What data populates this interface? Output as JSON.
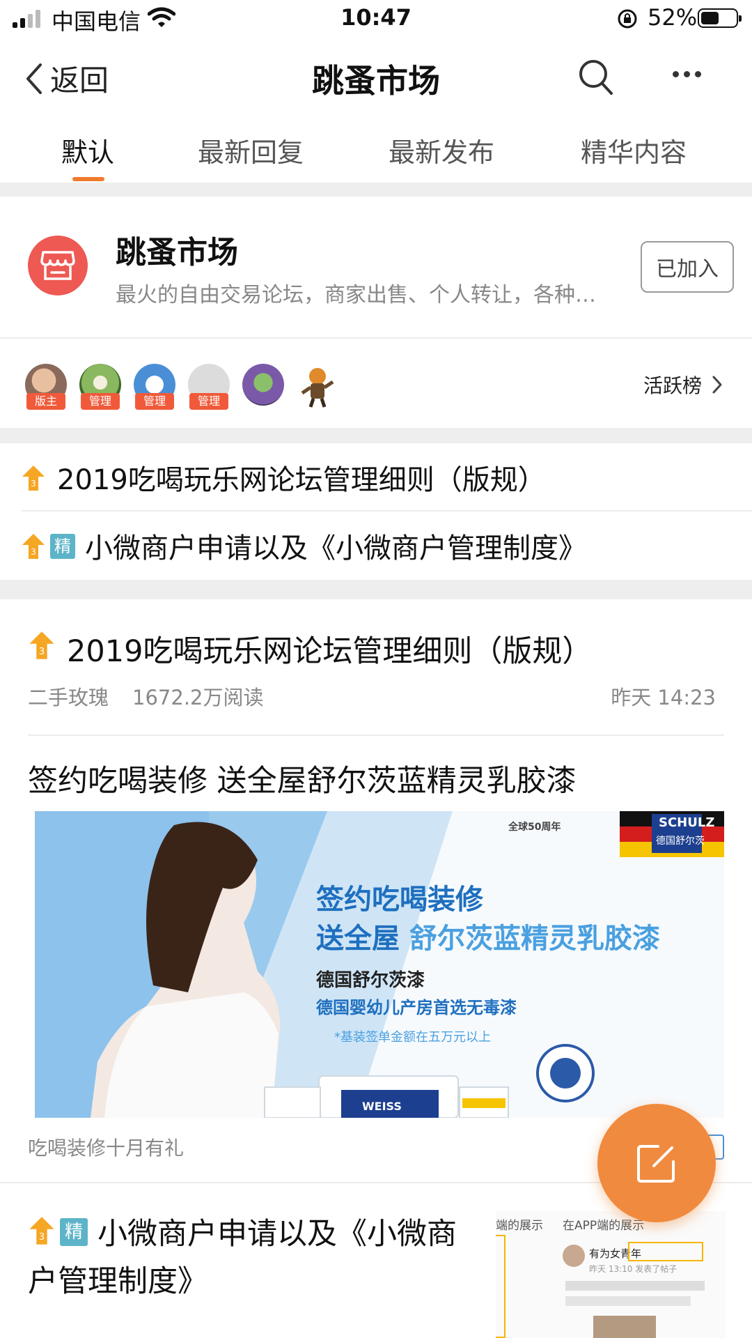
{
  "status_bar": {
    "carrier": "中国电信",
    "time": "10:47",
    "battery": "52%",
    "battery_level": 0.52
  },
  "nav": {
    "back_label": "返回",
    "title": "跳蚤市场"
  },
  "tabs": [
    {
      "label": "默认",
      "active": true
    },
    {
      "label": "最新回复",
      "active": false
    },
    {
      "label": "最新发布",
      "active": false
    },
    {
      "label": "精华内容",
      "active": false
    }
  ],
  "forum": {
    "name": "跳蚤市场",
    "description": "最火的自由交易论坛，商家出售、个人转让，各种…",
    "join_label": "已加入"
  },
  "moderators": [
    {
      "tag": "版主",
      "color": "#b08a70"
    },
    {
      "tag": "管理",
      "color": "#7aa65a"
    },
    {
      "tag": "管理",
      "color": "#4a8fd6"
    },
    {
      "tag": "管理",
      "color": "#d4d4d4"
    },
    {
      "tag": "",
      "color": "#7a5aa8"
    },
    {
      "tag": "",
      "color": "#e08a2c"
    }
  ],
  "active_rank_label": "活跃榜",
  "pinned": [
    {
      "title": "2019吃喝玩乐网论坛管理细则（版规）",
      "jing": false
    },
    {
      "title": "小微商户申请以及《小微商户管理制度》",
      "jing": true,
      "jing_label": "精"
    }
  ],
  "posts": [
    {
      "title": "2019吃喝玩乐网论坛管理细则（版规）",
      "author": "二手玫瑰",
      "reads": "1672.2万阅读",
      "time": "昨天 14:23"
    },
    {
      "title": "签约吃喝装修  送全屋舒尔茨蓝精灵乳胶漆",
      "caption": "吃喝装修十月有礼"
    },
    {
      "title_line1": "小微商户申请以及《小微商",
      "title_line2": "户管理制度》",
      "jing_label": "精"
    }
  ],
  "ad": {
    "anniversary": "全球50周年",
    "brand": "SCHULZ",
    "brand_cn": "德国舒尔茨",
    "headline1": "签约吃喝装修",
    "headline2a": "送全屋",
    "headline2b": "舒尔茨蓝精灵乳胶漆",
    "sub1": "德国舒尔茨漆",
    "sub2": "德国婴幼儿产房首选无毒漆",
    "note": "*基装签单金额在五万元以上",
    "can_label": "WEISS"
  },
  "thumb": {
    "label_left": "端的展示",
    "label_right": "在APP端的展示",
    "user": "有为女青年",
    "meta": "昨天 13:10 发表了帖子"
  },
  "colors": {
    "accent": "#f07a2c",
    "forum_logo": "#ee5953",
    "mod_tag": "#f05a3a",
    "jing": "#5db4c8",
    "fab": "#f08a3e"
  }
}
